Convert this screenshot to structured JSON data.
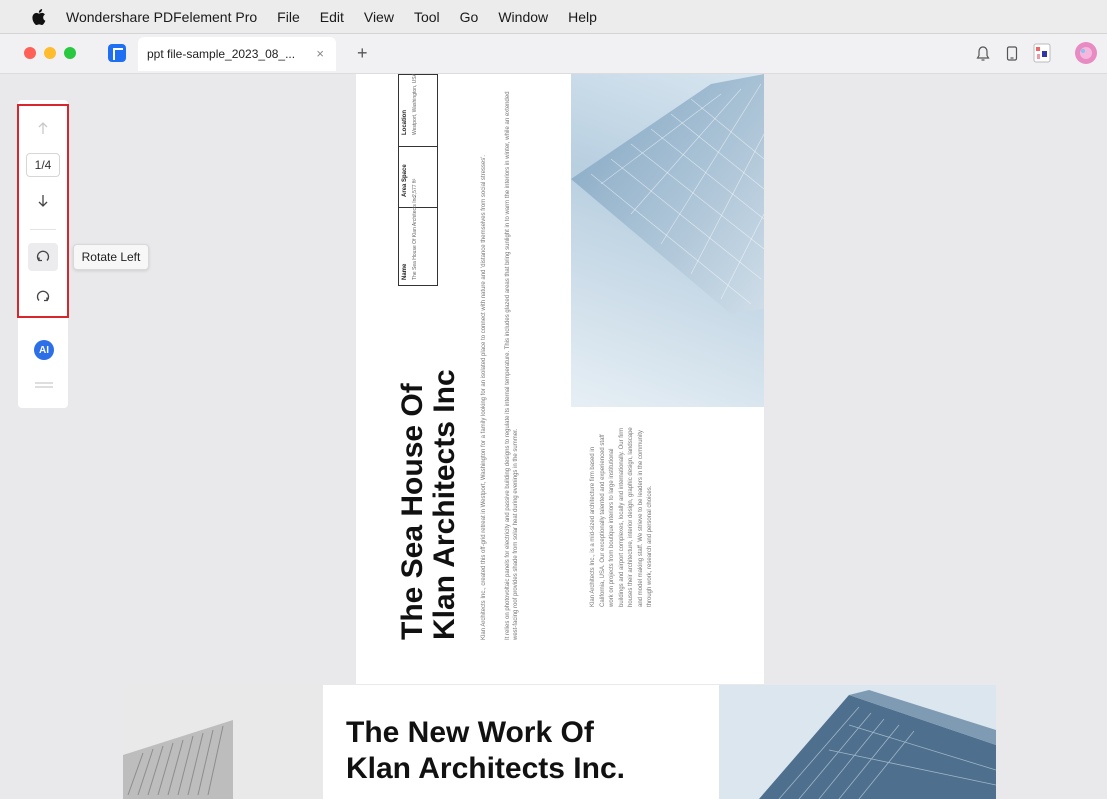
{
  "menubar": {
    "app_name": "Wondershare PDFelement Pro",
    "items": [
      "File",
      "Edit",
      "View",
      "Tool",
      "Go",
      "Window",
      "Help"
    ]
  },
  "tab": {
    "title": "ppt file-sample_2023_08_...",
    "close": "×",
    "new_tab": "+"
  },
  "toolbar": {
    "page_indicator": "1/4",
    "rotate_left_tooltip": "Rotate Left",
    "ai_label": "AI"
  },
  "page1": {
    "title_line1": "The Sea House Of",
    "title_line2": "Klan Architects Inc",
    "table": [
      {
        "head": "Location",
        "body": "Westport, Washington, USA"
      },
      {
        "head": "Area Space",
        "body": "2,577 ft²"
      },
      {
        "head": "Name",
        "body": "The Sea House Of Klan Architects Inc"
      }
    ],
    "paragraph1": "Klan Architects Inc., created this off-grid retreat in Westport, Washington for a family looking for an isolated place to connect with nature and 'distance themselves from social stresses'.",
    "paragraph2": "It relies on photovoltaic panels for electricity and passive building designs to regulate its internal temperature. This includes glazed areas that bring sunlight in to warm the interiors in winter, while an extended west-facing roof provides shade from solar heat during evenings in the summer.",
    "column_text": "Klan Architects Inc., is a mid-sized architecture firm based in California, USA. Our exceptionally talented and experienced staff work on projects from boutique interiors to large institutional buildings and airport complexes, locally and internationally. Our firm houses their architecture, interior design, graphic design, landscape and model making staff. We strieve to be leaders in the community through work, research and personal choices."
  },
  "page2": {
    "title_line1": "The New Work Of",
    "title_line2": "Klan Architects Inc."
  },
  "colors": {
    "accent_red": "#d7262c",
    "brand_blue": "#1f6ff2",
    "ai_blue": "#2d6fe7"
  }
}
